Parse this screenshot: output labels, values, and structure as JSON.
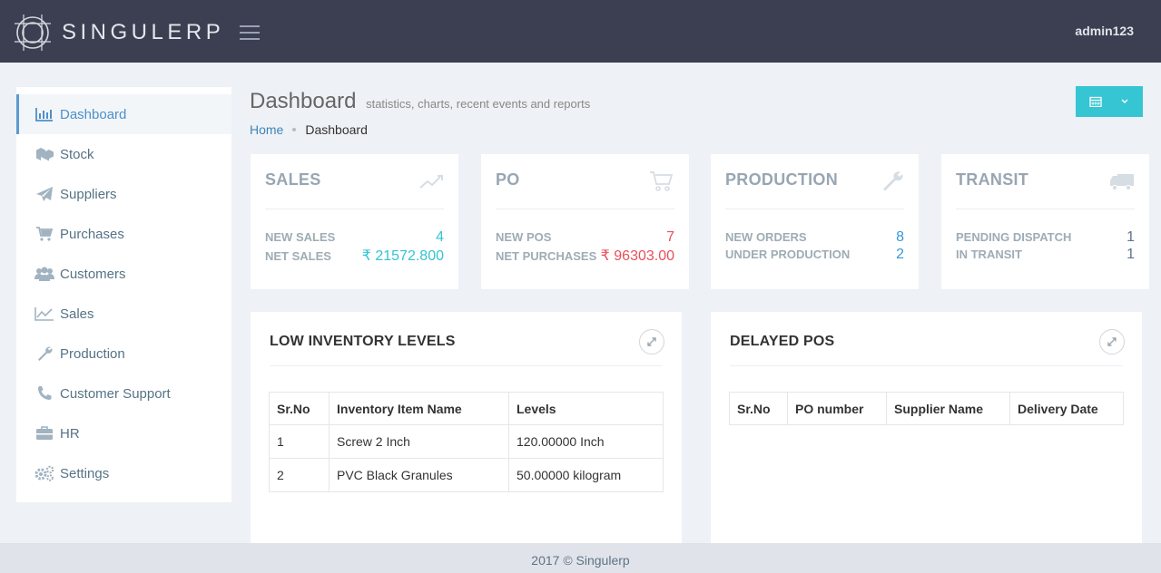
{
  "header": {
    "brand": "SINGULERP",
    "user": "admin123"
  },
  "sidebar": {
    "items": [
      {
        "label": "Dashboard",
        "icon": "bar-chart-icon",
        "active": true
      },
      {
        "label": "Stock",
        "icon": "cubes-icon"
      },
      {
        "label": "Suppliers",
        "icon": "paper-plane-icon"
      },
      {
        "label": "Purchases",
        "icon": "cart-icon"
      },
      {
        "label": "Customers",
        "icon": "users-icon"
      },
      {
        "label": "Sales",
        "icon": "line-chart-icon"
      },
      {
        "label": "Production",
        "icon": "wrench-icon"
      },
      {
        "label": "Customer Support",
        "icon": "phone-icon"
      },
      {
        "label": "HR",
        "icon": "briefcase-icon"
      },
      {
        "label": "Settings",
        "icon": "cogs-icon"
      }
    ]
  },
  "page": {
    "title": "Dashboard",
    "subtitle": "statistics, charts, recent events and reports",
    "breadcrumb": {
      "home": "Home",
      "current": "Dashboard"
    }
  },
  "cards": [
    {
      "title": "SALES",
      "icon": "trend-icon",
      "rows": [
        {
          "label": "NEW SALES",
          "value": "4",
          "color": "#32c5d2"
        },
        {
          "label": "NET SALES",
          "value": "₹ 21572.800",
          "color": "#32c5d2"
        }
      ]
    },
    {
      "title": "PO",
      "icon": "cart-icon",
      "rows": [
        {
          "label": "NEW POS",
          "value": "7",
          "color": "#e7505a"
        },
        {
          "label": "NET PURCHASES",
          "value": "₹ 96303.00",
          "color": "#e7505a"
        }
      ]
    },
    {
      "title": "PRODUCTION",
      "icon": "wrench-icon",
      "rows": [
        {
          "label": "NEW ORDERS",
          "value": "8",
          "color": "#3598dc"
        },
        {
          "label": "UNDER PRODUCTION",
          "value": "2",
          "color": "#3598dc"
        }
      ]
    },
    {
      "title": "TRANSIT",
      "icon": "truck-icon",
      "rows": [
        {
          "label": "PENDING DISPATCH",
          "value": "1",
          "color": "#5e738b"
        },
        {
          "label": "IN TRANSIT",
          "value": "1",
          "color": "#5e738b"
        }
      ]
    }
  ],
  "low_inventory": {
    "title": "LOW INVENTORY LEVELS",
    "columns": [
      "Sr.No",
      "Inventory Item Name",
      "Levels"
    ],
    "rows": [
      [
        "1",
        "Screw 2 Inch",
        "120.00000 Inch"
      ],
      [
        "2",
        "PVC Black Granules",
        "50.00000 kilogram"
      ]
    ]
  },
  "delayed_pos": {
    "title": "DELAYED POS",
    "columns": [
      "Sr.No",
      "PO number",
      "Supplier Name",
      "Delivery Date"
    ],
    "rows": []
  },
  "footer": "2017 © Singulerp"
}
